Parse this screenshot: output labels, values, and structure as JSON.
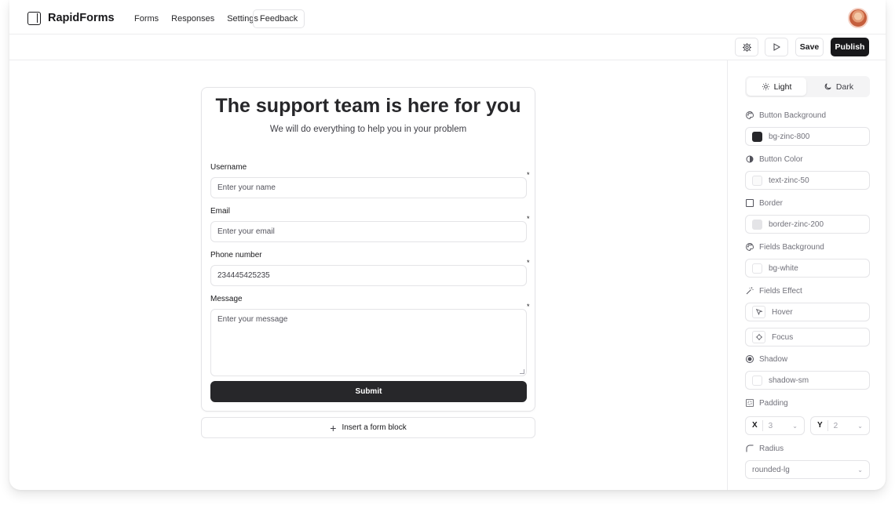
{
  "app": {
    "name": "RapidForms"
  },
  "nav": {
    "links": [
      "Forms",
      "Responses",
      "Settings"
    ],
    "feedback": "Feedback"
  },
  "toolbar": {
    "save": "Save",
    "publish": "Publish"
  },
  "form": {
    "title": "The support team is here for you",
    "subtitle": "We will do everything to help you in your problem",
    "fields": [
      {
        "label": "Username",
        "placeholder": "Enter your name",
        "required": "*"
      },
      {
        "label": "Email",
        "placeholder": "Enter your email",
        "required": "*"
      },
      {
        "label": "Phone number",
        "value": "234445425235",
        "required": "*"
      },
      {
        "label": "Message",
        "placeholder": "Enter your message",
        "required": "*"
      }
    ],
    "submit": "Submit",
    "insert_block": "Insert a form block"
  },
  "panel": {
    "theme": {
      "light": "Light",
      "dark": "Dark",
      "selected": "Light"
    },
    "button_background": {
      "label": "Button Background",
      "value": "bg-zinc-800",
      "swatch": "#27272a"
    },
    "button_color": {
      "label": "Button Color",
      "value": "text-zinc-50",
      "swatch": "#fafafa"
    },
    "border": {
      "label": "Border",
      "value": "border-zinc-200",
      "swatch": "#e4e4e7"
    },
    "fields_background": {
      "label": "Fields Background",
      "value": "bg-white",
      "swatch": "#ffffff"
    },
    "fields_effect": {
      "label": "Fields Effect",
      "hover": "Hover",
      "focus": "Focus"
    },
    "shadow": {
      "label": "Shadow",
      "value": "shadow-sm"
    },
    "padding": {
      "label": "Padding",
      "x_label": "X",
      "x_value": "3",
      "y_label": "Y",
      "y_value": "2"
    },
    "radius": {
      "label": "Radius",
      "value": "rounded-lg"
    }
  },
  "colors": {
    "accent": "#18181b",
    "border": "#e4e4e7"
  }
}
